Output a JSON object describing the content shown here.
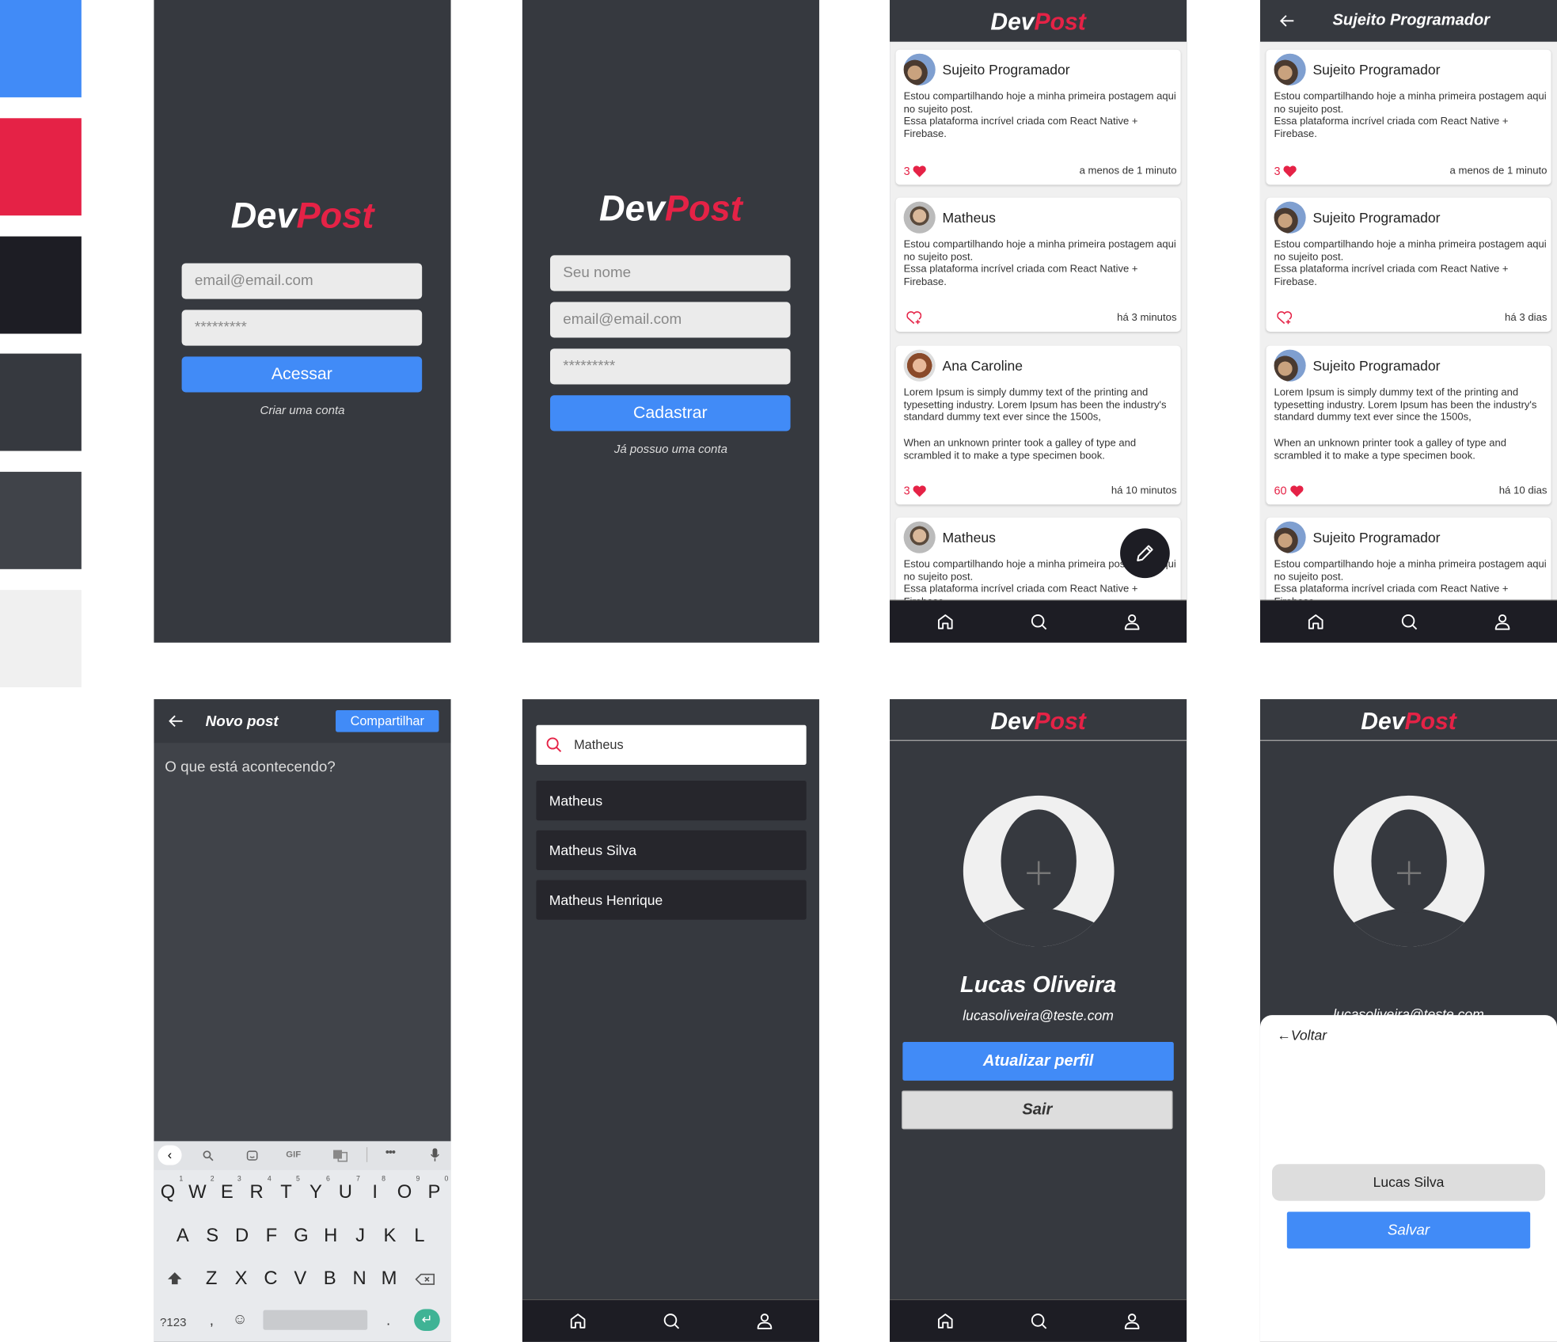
{
  "palette": [
    "#418bf7",
    "#e52246",
    "#1d1d24",
    "#36393f",
    "#404349",
    "#f0f0f0"
  ],
  "brand": {
    "dev": "Dev",
    "post": "Post",
    "accent": "#e52246",
    "primary": "#418bf7"
  },
  "login": {
    "email_placeholder": "email@email.com",
    "password_placeholder": "*********",
    "submit": "Acessar",
    "switch_link": "Criar uma conta"
  },
  "signup": {
    "name_placeholder": "Seu nome",
    "email_placeholder": "email@email.com",
    "password_placeholder": "*********",
    "submit": "Cadastrar",
    "switch_link": "Já possuo uma conta"
  },
  "home_feed": {
    "posts": [
      {
        "author": "Sujeito Programador",
        "avatar": "sujeito",
        "body": "Estou compartilhando hoje a minha primeira postagem aqui no sujeito post.\nEssa plataforma incrível criada com React Native + Firebase.",
        "likes": "3",
        "liked": true,
        "time": "a menos de 1 minuto"
      },
      {
        "author": "Matheus",
        "avatar": "matheus",
        "body": "Estou compartilhando hoje a minha primeira postagem aqui no sujeito post.\nEssa plataforma incrível criada com React Native + Firebase.",
        "likes": "",
        "liked": false,
        "time": "há 3 minutos"
      },
      {
        "author": "Ana Caroline",
        "avatar": "ana",
        "body": "Lorem Ipsum is simply dummy text of the printing and typesetting industry. Lorem Ipsum has been the industry's standard dummy text ever since the 1500s,\n\nWhen an unknown printer took a galley of type and scrambled it to make a type specimen book.",
        "likes": "3",
        "liked": true,
        "time": "há 10 minutos"
      },
      {
        "author": "Matheus",
        "avatar": "matheus",
        "body": "Estou compartilhando hoje a minha primeira postagem aqui no sujeito post.\nEssa plataforma incrível criada com React Native + Firebase.",
        "likes": "",
        "liked": false,
        "time": ""
      }
    ]
  },
  "user_feed": {
    "title": "Sujeito Programador",
    "posts": [
      {
        "author": "Sujeito Programador",
        "avatar": "sujeito",
        "body": "Estou compartilhando hoje a minha primeira postagem aqui no sujeito post.\nEssa plataforma incrível criada com React Native + Firebase.",
        "likes": "3",
        "liked": true,
        "time": "a menos de 1 minuto"
      },
      {
        "author": "Sujeito Programador",
        "avatar": "sujeito",
        "body": "Estou compartilhando hoje a minha primeira postagem aqui no sujeito post.\nEssa plataforma incrível criada com React Native + Firebase.",
        "likes": "",
        "liked": false,
        "time": "há 3 dias"
      },
      {
        "author": "Sujeito Programador",
        "avatar": "sujeito",
        "body": "Lorem Ipsum is simply dummy text of the printing and typesetting industry. Lorem Ipsum has been the industry's standard dummy text ever since the 1500s,\n\nWhen an unknown printer took a galley of type and scrambled it to make a type specimen book.",
        "likes": "60",
        "liked": true,
        "time": "há 10 dias"
      },
      {
        "author": "Sujeito Programador",
        "avatar": "sujeito",
        "body": "Estou compartilhando hoje a minha primeira postagem aqui no sujeito post.\nEssa plataforma incrível criada com React Native + Firebase.",
        "likes": "",
        "liked": false,
        "time": ""
      }
    ]
  },
  "new_post": {
    "title": "Novo post",
    "share": "Compartilhar",
    "placeholder": "O que está acontecendo?"
  },
  "keyboard": {
    "toolbar": [
      "search-icon",
      "sticker-icon",
      "GIF",
      "translate-icon",
      "more-icon",
      "mic-icon"
    ],
    "row1": [
      "Q",
      "W",
      "E",
      "R",
      "T",
      "Y",
      "U",
      "I",
      "O",
      "P"
    ],
    "row1_hints": [
      "1",
      "2",
      "3",
      "4",
      "5",
      "6",
      "7",
      "8",
      "9",
      "0"
    ],
    "row2": [
      "A",
      "S",
      "D",
      "F",
      "G",
      "H",
      "J",
      "K",
      "L"
    ],
    "row3": [
      "Z",
      "X",
      "C",
      "V",
      "B",
      "N",
      "M"
    ],
    "symbols": "?123",
    "comma": ",",
    "period": "."
  },
  "search": {
    "query": "Matheus",
    "results": [
      "Matheus",
      "Matheus Silva",
      "Matheus Henrique"
    ]
  },
  "profile": {
    "name": "Lucas Oliveira",
    "email": "lucasoliveira@teste.com",
    "update": "Atualizar perfil",
    "logout": "Sair"
  },
  "edit_profile": {
    "email": "lucasoliveira@teste.com",
    "back": "Voltar",
    "name_value": "Lucas Silva",
    "save": "Salvar"
  }
}
